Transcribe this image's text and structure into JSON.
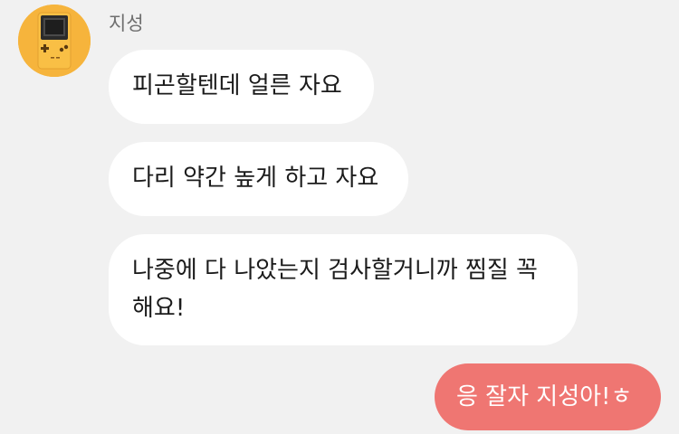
{
  "chat": {
    "contact": {
      "name": "지성",
      "avatar_icon": "gameboy-icon",
      "avatar_color": "#f6b43c"
    },
    "messages": [
      {
        "direction": "incoming",
        "text": "피곤할텐데 얼른 자요"
      },
      {
        "direction": "incoming",
        "text": "다리 약간 높게 하고 자요"
      },
      {
        "direction": "incoming",
        "text": "나중에 다 나았는지 검사할거니까 찜질 꼭 해요!"
      },
      {
        "direction": "outgoing",
        "text": "응 잘자 지성아!ㅎ"
      }
    ],
    "colors": {
      "background": "#f1f1f1",
      "incoming_bubble": "#ffffff",
      "outgoing_bubble": "#ef7672"
    }
  }
}
